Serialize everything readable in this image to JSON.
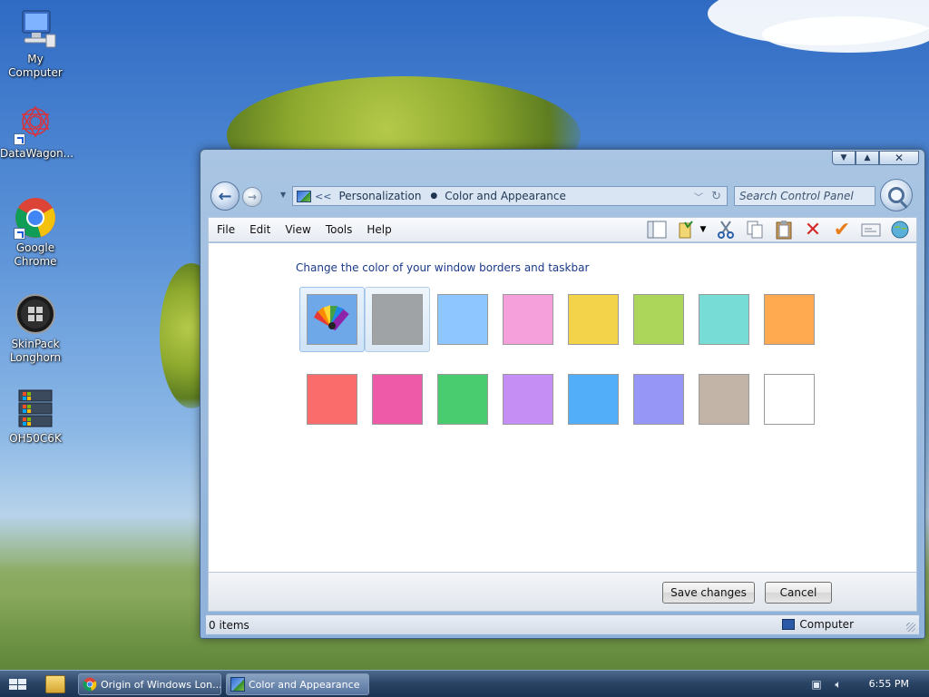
{
  "desktop": {
    "icons": [
      {
        "label": "My Computer",
        "icon": "computer-icon"
      },
      {
        "label": "DataWagon...",
        "icon": "datawagon-icon"
      },
      {
        "label": "Google Chrome",
        "icon": "chrome-icon"
      },
      {
        "label": "SkinPack Longhorn",
        "icon": "skinpack-icon"
      },
      {
        "label": "OH50C6K",
        "icon": "windows-flag-icon"
      }
    ]
  },
  "window": {
    "caption": {
      "minimize": "minimize-icon",
      "maximize": "maximize-icon",
      "close": "close-icon"
    },
    "breadcrumb": {
      "prefix": "<<",
      "item1": "Personalization",
      "item2": "Color and Appearance"
    },
    "search_placeholder": "Search Control Panel",
    "menu": [
      "File",
      "Edit",
      "View",
      "Tools",
      "Help"
    ],
    "toolbar_icons": [
      "preview-pane-icon",
      "folder-options-icon",
      "cut-icon",
      "copy-icon",
      "paste-icon",
      "delete-icon",
      "checkmark-icon",
      "properties-icon",
      "globe-icon"
    ],
    "heading": "Change the color of your window borders and taskbar",
    "swatches": [
      {
        "name": "custom",
        "color": "#6fa8e8",
        "selected": true
      },
      {
        "name": "graphite",
        "color": "#a0a3a6"
      },
      {
        "name": "sky",
        "color": "#8ec6ff"
      },
      {
        "name": "pink",
        "color": "#f5a0da"
      },
      {
        "name": "yellow",
        "color": "#f2d349"
      },
      {
        "name": "lime",
        "color": "#abd65a"
      },
      {
        "name": "teal",
        "color": "#78dcd6"
      },
      {
        "name": "orange",
        "color": "#ffaa50"
      },
      {
        "name": "red",
        "color": "#fa6c6c"
      },
      {
        "name": "magenta",
        "color": "#ef5aa8"
      },
      {
        "name": "green",
        "color": "#49cc70"
      },
      {
        "name": "violet",
        "color": "#c48ef4"
      },
      {
        "name": "blue",
        "color": "#52aef8"
      },
      {
        "name": "periwinkle",
        "color": "#9696f6"
      },
      {
        "name": "taupe",
        "color": "#c2b4a6"
      },
      {
        "name": "white",
        "color": "#ffffff"
      }
    ],
    "buttons": {
      "save": "Save changes",
      "cancel": "Cancel"
    },
    "status": {
      "items": "0 items",
      "location": "Computer"
    }
  },
  "taskbar": {
    "tasks": [
      {
        "label": "Origin of Windows Lon...",
        "icon": "chrome-icon"
      },
      {
        "label": "Color and Appearance",
        "icon": "control-panel-icon"
      }
    ],
    "clock": "6:55 PM"
  }
}
